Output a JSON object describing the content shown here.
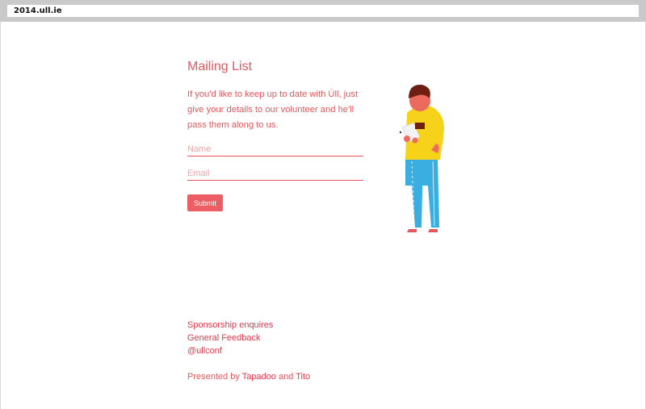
{
  "browser": {
    "url": "2014.ull.ie"
  },
  "mailing": {
    "title": "Mailing List",
    "intro": "If you'd like to keep up to date with Úll, just give your details to our volunteer and he'll pass them along to us.",
    "name_placeholder": "Name",
    "email_placeholder": "Email",
    "submit_label": "Submit"
  },
  "footer": {
    "sponsorship": "Sponsorship enquires",
    "feedback": "General Feedback",
    "twitter": "@ullconf",
    "presented_prefix": "Presented by ",
    "tapadoo": "Tapadoo",
    "and": " and ",
    "tito": "Tito"
  },
  "colors": {
    "accent": "#e8565b",
    "link": "#e2374a",
    "button": "#ec5e63"
  },
  "icons": {
    "illustration": "volunteer-illustration"
  }
}
